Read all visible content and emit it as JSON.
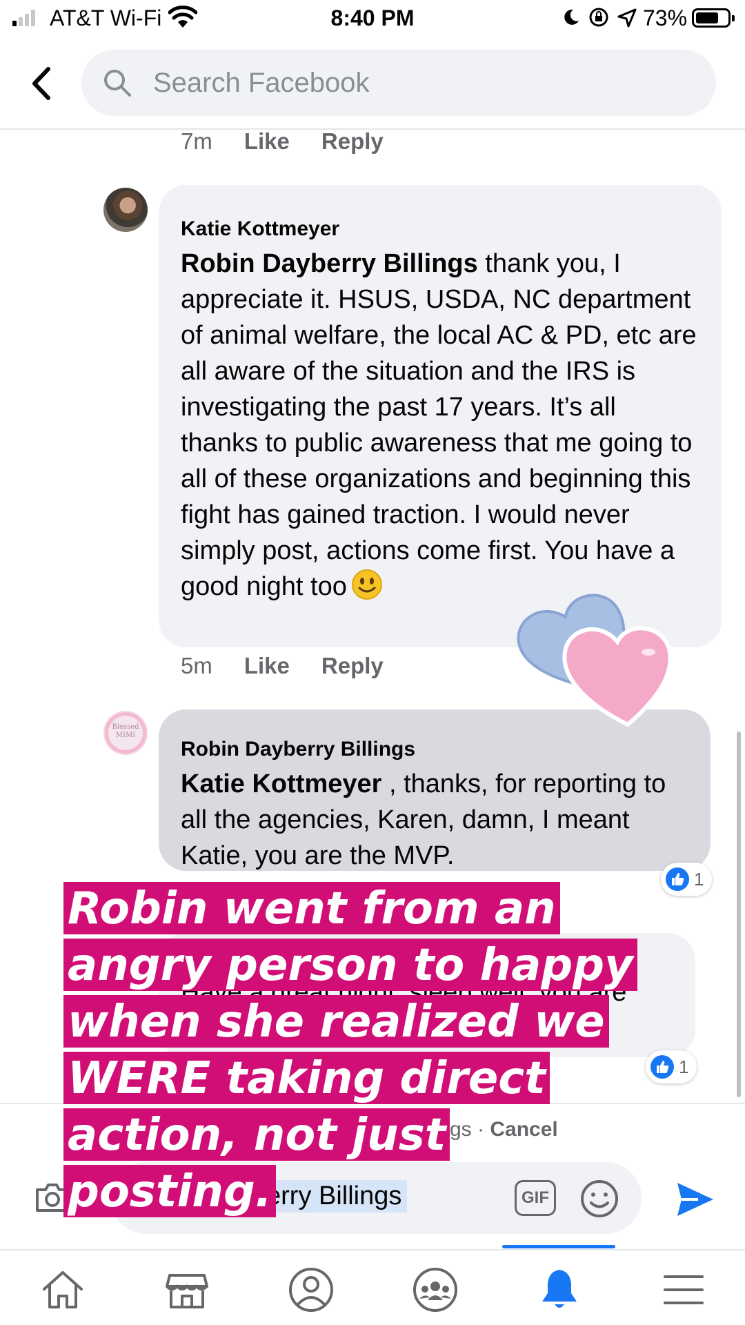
{
  "status_bar": {
    "carrier": "AT&T Wi-Fi",
    "time": "8:40 PM",
    "battery": "73%",
    "battery_level": 0.73
  },
  "header": {
    "search_placeholder": "Search Facebook"
  },
  "comments": [
    {
      "time": "7m",
      "like_label": "Like",
      "reply_label": "Reply"
    },
    {
      "author": "Katie Kottmeyer",
      "mention": "Robin Dayberry Billings",
      "text": " thank you, I appreciate it. HSUS, USDA, NC department of animal welfare, the local AC & PD, etc are all aware of the situation and the IRS is investigating the past 17 years. It’s all thanks to public awareness that me going to all of these organizations and beginning this fight has gained traction. I would never simply post, actions come first. You have a good night too",
      "time": "5m",
      "like_label": "Like",
      "reply_label": "Reply"
    },
    {
      "author": "Robin Dayberry Billings",
      "mention": "Katie Kottmeyer",
      "text": " , thanks, for reporting to all the agencies, Karen, damn, I meant Katie, you are the MVP.",
      "likes": "1",
      "avatar_text": "Blessed MIMI"
    },
    {
      "partial_text": "Have a great night, sleep well, you are",
      "likes": "1"
    }
  ],
  "reply_bar": {
    "replying_to": "gs",
    "separator": " · ",
    "cancel_label": "Cancel",
    "input_value": "erry Billings",
    "gif_label": "GIF"
  },
  "caption": {
    "lines": [
      "Robin went from an",
      "angry person to happy",
      "when she realized we",
      "WERE taking direct",
      "action, not just",
      "posting."
    ],
    "background_color": "#d10e76"
  },
  "bottom_nav": {
    "active_tab": "notifications",
    "accent_color": "#1877f2"
  }
}
